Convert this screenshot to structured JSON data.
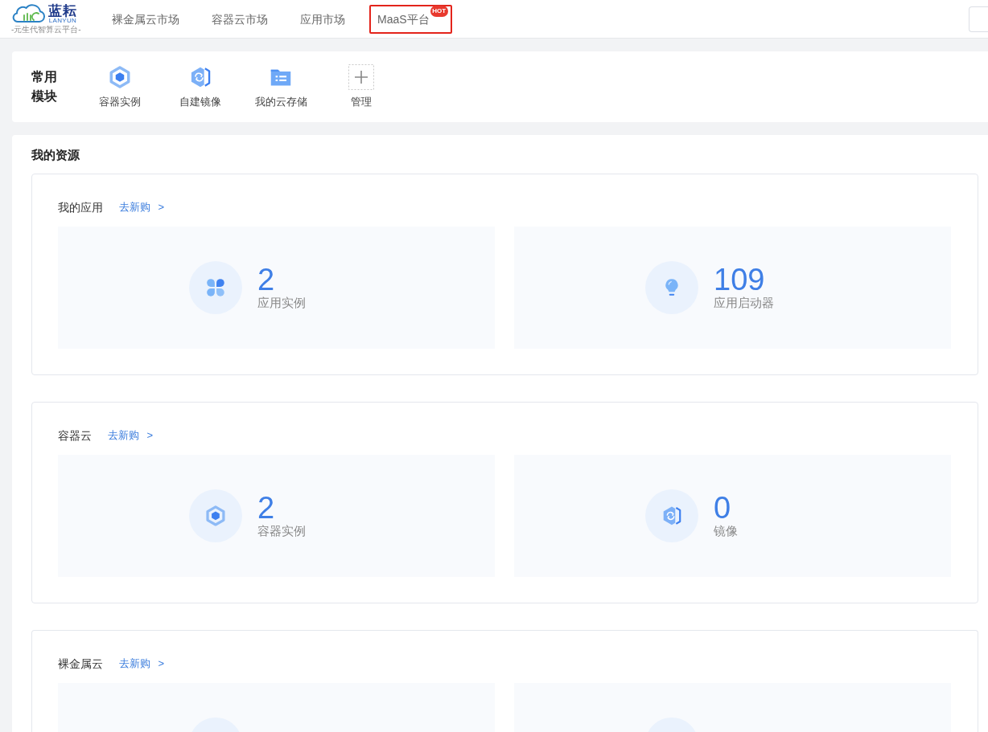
{
  "header": {
    "logo": {
      "title": "蓝耘",
      "subtitle": "LANYUN",
      "tagline": "-元生代智算云平台-"
    },
    "nav": [
      {
        "label": "裸金属云市场",
        "highlighted": false
      },
      {
        "label": "容器云市场",
        "highlighted": false
      },
      {
        "label": "应用市场",
        "highlighted": false
      },
      {
        "label": "MaaS平台",
        "highlighted": true,
        "badge": "HOT"
      }
    ]
  },
  "quick_modules": {
    "title": "常用模块",
    "items": [
      {
        "kind": "container",
        "label": "容器实例"
      },
      {
        "kind": "image",
        "label": "自建镜像"
      },
      {
        "kind": "storage",
        "label": "我的云存储"
      },
      {
        "kind": "manage",
        "label": "管理"
      }
    ]
  },
  "resources": {
    "title": "我的资源",
    "sections": [
      {
        "title": "我的应用",
        "link": "去新购 >",
        "cards": [
          {
            "kind": "apps",
            "value": "2",
            "label": "应用实例"
          },
          {
            "kind": "launcher",
            "value": "109",
            "label": "应用启动器"
          }
        ]
      },
      {
        "title": "容器云",
        "link": "去新购 >",
        "cards": [
          {
            "kind": "container",
            "value": "2",
            "label": "容器实例"
          },
          {
            "kind": "image",
            "value": "0",
            "label": "镜像"
          }
        ]
      },
      {
        "title": "裸金属云",
        "link": "去新购 >",
        "cards": [
          {
            "kind": "cut"
          },
          {
            "kind": "cut"
          }
        ]
      }
    ]
  }
}
